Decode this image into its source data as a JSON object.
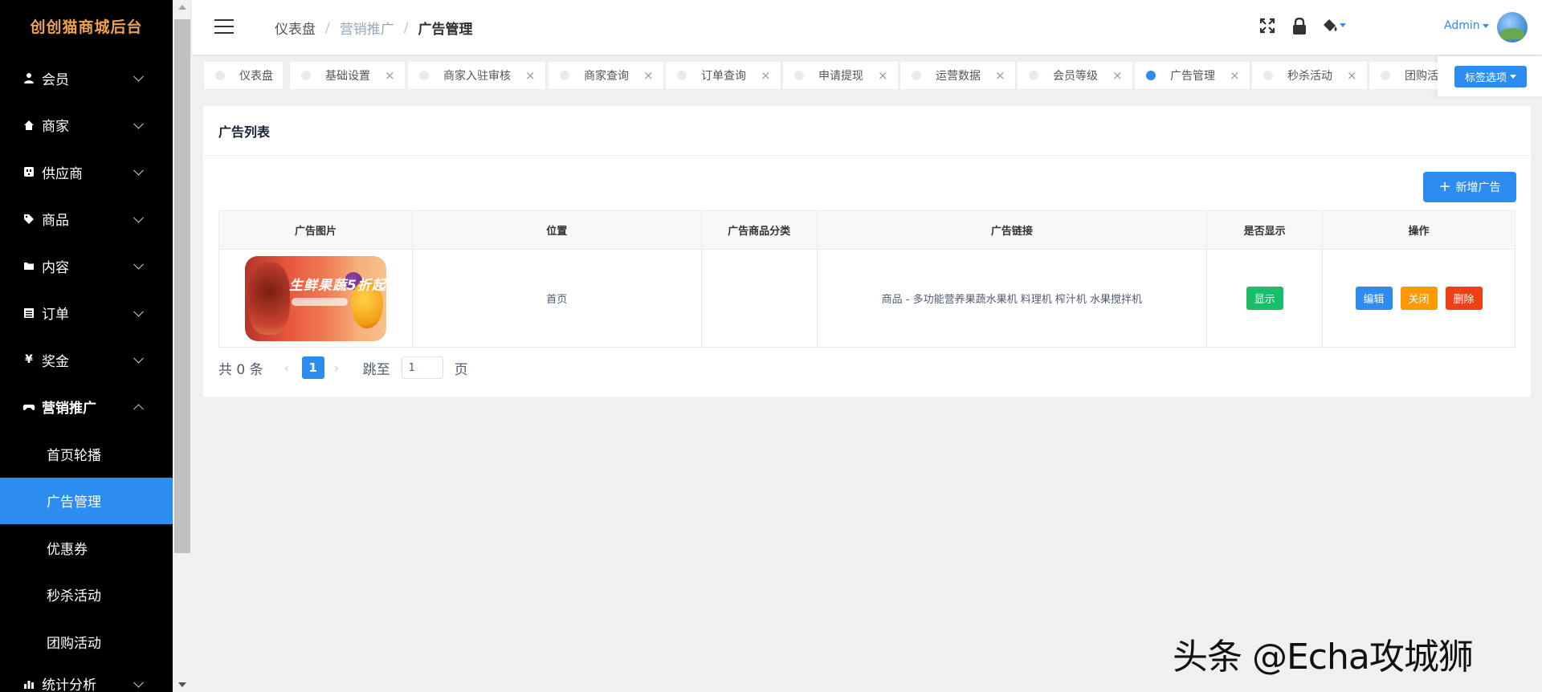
{
  "sidebar": {
    "logo": "创创猫商城后台",
    "items": [
      {
        "label": "会员",
        "icon": "user-icon"
      },
      {
        "label": "商家",
        "icon": "home-icon"
      },
      {
        "label": "供应商",
        "icon": "outlet-icon"
      },
      {
        "label": "商品",
        "icon": "tag-icon"
      },
      {
        "label": "内容",
        "icon": "folder-icon"
      },
      {
        "label": "订单",
        "icon": "list-icon"
      },
      {
        "label": "奖金",
        "icon": "yen-icon"
      },
      {
        "label": "营销推广",
        "icon": "gamepad-icon"
      }
    ],
    "sub_items": [
      {
        "label": "首页轮播"
      },
      {
        "label": "广告管理"
      },
      {
        "label": "优惠券"
      },
      {
        "label": "秒杀活动"
      },
      {
        "label": "团购活动"
      }
    ],
    "last_item": {
      "label": "统计分析",
      "icon": "chart-icon"
    }
  },
  "header": {
    "breadcrumb": [
      "仪表盘",
      "营销推广",
      "广告管理"
    ],
    "user": "Admin"
  },
  "tags": {
    "items": [
      {
        "label": "仪表盘"
      },
      {
        "label": "基础设置"
      },
      {
        "label": "商家入驻审核"
      },
      {
        "label": "商家查询"
      },
      {
        "label": "订单查询"
      },
      {
        "label": "申请提现"
      },
      {
        "label": "运营数据"
      },
      {
        "label": "会员等级"
      },
      {
        "label": "广告管理"
      },
      {
        "label": "秒杀活动"
      },
      {
        "label": "团购活"
      }
    ],
    "options_label": "标签选项"
  },
  "card": {
    "title": "广告列表",
    "add_button": "新增广告",
    "columns": [
      "广告图片",
      "位置",
      "广告商品分类",
      "广告链接",
      "是否显示",
      "操作"
    ],
    "rows": [
      {
        "image_text": "生鲜果蔬5折起",
        "position": "首页",
        "category": "",
        "link": "商品 - 多功能营养果蔬水果机 料理机 榨汁机 水果搅拌机",
        "display": "显示",
        "actions": [
          "编辑",
          "关闭",
          "删除"
        ]
      }
    ]
  },
  "pager": {
    "total": "共 0 条",
    "current_page": "1",
    "jump_label": "跳至",
    "jump_value": "1",
    "page_label": "页"
  },
  "watermark": "头条 @Echa攻城狮",
  "colors": {
    "primary": "#2d8cf0",
    "success": "#19be6b",
    "warning": "#ff9900",
    "danger": "#ed4014",
    "logo": "#f0a24a"
  }
}
